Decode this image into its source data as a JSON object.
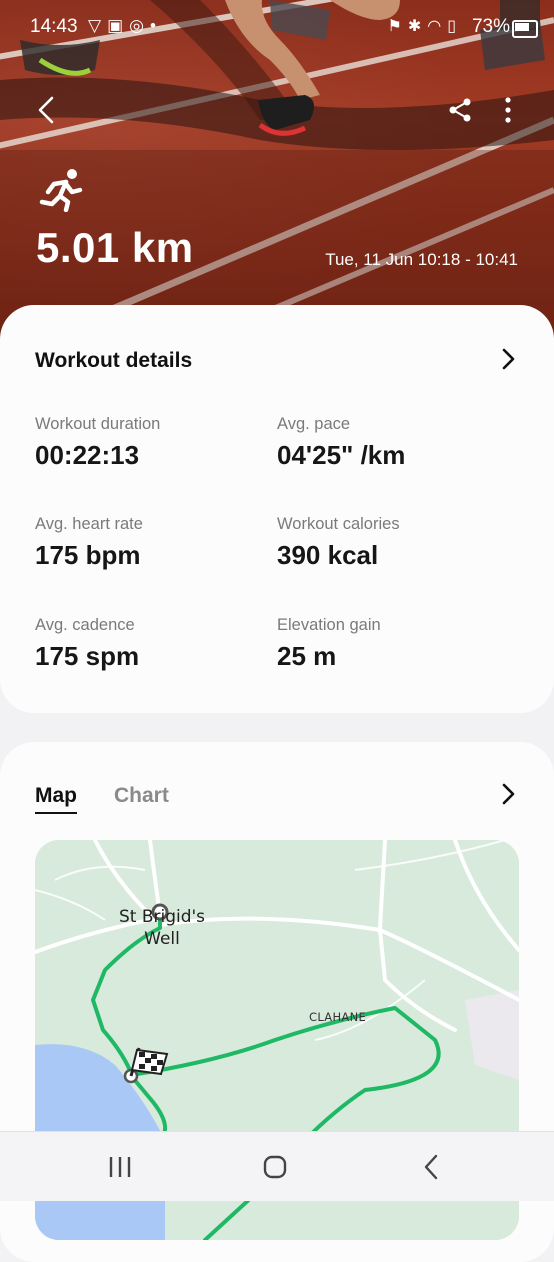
{
  "status_bar": {
    "time": "14:43",
    "battery": "73%"
  },
  "header": {
    "distance": "5.01 km",
    "datetime": "Tue, 11 Jun 10:18 - 10:41",
    "activity_icon": "running-icon"
  },
  "workout_details": {
    "title": "Workout details",
    "stats": [
      {
        "label": "Workout duration",
        "value": "00:22:13"
      },
      {
        "label": "Avg. pace",
        "value": "04'25\" /km"
      },
      {
        "label": "Avg. heart rate",
        "value": "175 bpm"
      },
      {
        "label": "Workout calories",
        "value": "390 kcal"
      },
      {
        "label": "Avg. cadence",
        "value": "175 spm"
      },
      {
        "label": "Elevation gain",
        "value": "25 m"
      }
    ]
  },
  "map_section": {
    "tabs": [
      {
        "label": "Map",
        "selected": true
      },
      {
        "label": "Chart",
        "selected": false
      }
    ],
    "map_labels": {
      "place": "St Brigid's Well",
      "townland": "CLAHANE"
    }
  },
  "colors": {
    "route": "#1fb865",
    "map_land": "#d8eadb",
    "water": "#a9c8f5",
    "track": "#9c3722"
  }
}
